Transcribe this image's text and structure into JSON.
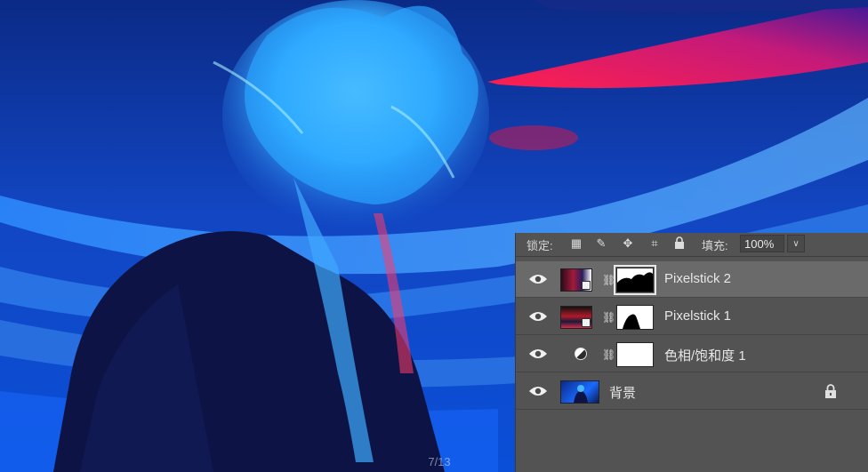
{
  "slide": {
    "counter": "7/13"
  },
  "layers_panel": {
    "lock_label": "锁定:",
    "lock_tools": [
      "checkerboard-icon",
      "brush-icon",
      "move-icon",
      "crop-icon",
      "lock-icon"
    ],
    "fill_label": "填充:",
    "fill_value": "100%",
    "layers": [
      {
        "name": "Pixelstick 2",
        "selected": true,
        "visible": true,
        "type": "smart-object-with-mask"
      },
      {
        "name": "Pixelstick 1",
        "selected": false,
        "visible": true,
        "type": "smart-object-with-mask"
      },
      {
        "name": "色相/饱和度 1",
        "selected": false,
        "visible": true,
        "type": "adjustment-layer"
      },
      {
        "name": "背景",
        "selected": false,
        "visible": true,
        "type": "background",
        "locked": true
      }
    ]
  },
  "colors": {
    "panel_bg": "#535353",
    "selected_row": "#6a6a6a",
    "photo_blue": "#0b3cc9",
    "accent_red": "#e0184a"
  }
}
